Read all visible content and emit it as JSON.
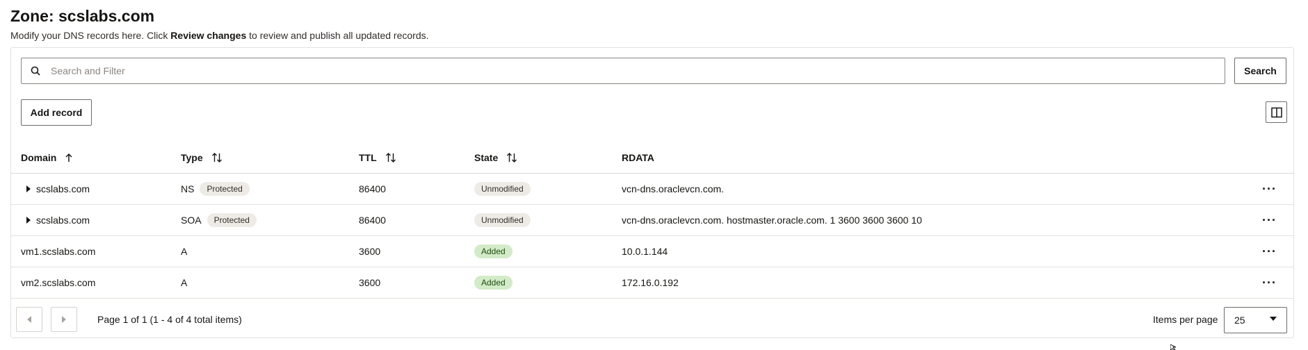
{
  "header": {
    "title": "Zone: scslabs.com",
    "desc_pre": "Modify your DNS records here. Click ",
    "desc_bold": "Review changes",
    "desc_post": " to review and publish all updated records."
  },
  "search": {
    "placeholder": "Search and Filter",
    "button_label": "Search"
  },
  "toolbar": {
    "add_record_label": "Add record"
  },
  "columns": {
    "domain": "Domain",
    "type": "Type",
    "ttl": "TTL",
    "state": "State",
    "rdata": "RDATA"
  },
  "rows": [
    {
      "domain": "scslabs.com",
      "type": "NS",
      "protected": "Protected",
      "ttl": "86400",
      "state": "Unmodified",
      "rdata": "vcn-dns.oraclevcn.com."
    },
    {
      "domain": "scslabs.com",
      "type": "SOA",
      "protected": "Protected",
      "ttl": "86400",
      "state": "Unmodified",
      "rdata": "vcn-dns.oraclevcn.com. hostmaster.oracle.com. 1 3600 3600 3600 10"
    },
    {
      "domain": "vm1.scslabs.com",
      "type": "A",
      "ttl": "3600",
      "state": "Added",
      "rdata": "10.0.1.144"
    },
    {
      "domain": "vm2.scslabs.com",
      "type": "A",
      "ttl": "3600",
      "state": "Added",
      "rdata": "172.16.0.192"
    }
  ],
  "row_actions": "···",
  "pagination": {
    "info": "Page 1 of 1 (1 - 4 of 4 total items)",
    "items_per_page_label": "Items per page",
    "items_per_page_value": "25"
  },
  "colors": {
    "added_badge": "#d3ebc8",
    "neutral_badge": "#eeebe7"
  }
}
